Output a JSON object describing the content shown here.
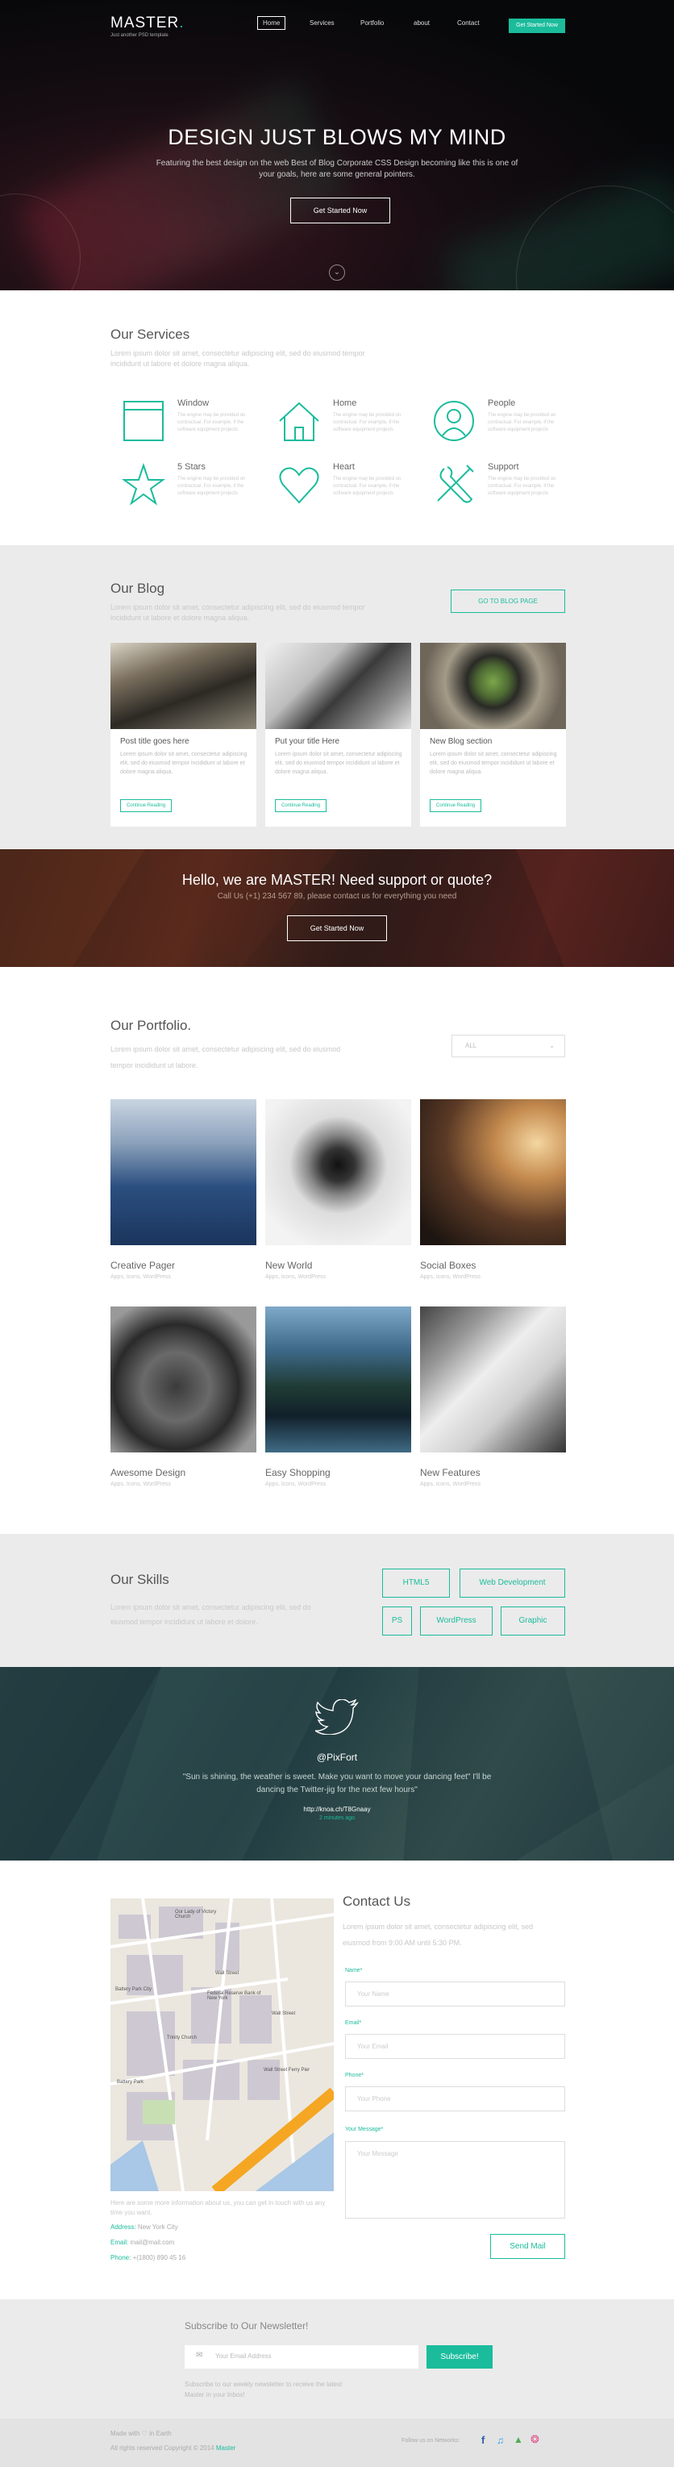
{
  "header": {
    "logo": "MASTER",
    "logo_dot": ".",
    "logo_sub": "Just another PSD template",
    "nav": [
      "Home",
      "Services",
      "Portfolio",
      "about",
      "Contact"
    ],
    "cta": "Get Started Now"
  },
  "hero": {
    "title": "DESIGN JUST BLOWS MY MIND",
    "subtitle": "Featuring the best design on the web Best of Blog Corporate CSS Design becoming like this is one of your goals, here are some general pointers.",
    "button": "Get Started Now"
  },
  "services": {
    "title": "Our Services",
    "intro": "Lorem ipsum dolor sit amet, consectetur adipiscing elit, sed do eiusmod tempor incididunt ut labore et dolore magna aliqua.",
    "items": [
      {
        "icon": "window-icon",
        "title": "Window",
        "desc": "The engine may be provided on contractual. For example, if the software equipment projects"
      },
      {
        "icon": "home-icon",
        "title": "Home",
        "desc": "The engine may be provided on contractual. For example, if the software equipment projects"
      },
      {
        "icon": "people-icon",
        "title": "People",
        "desc": "The engine may be provided on contractual. For example, if the software equipment projects"
      },
      {
        "icon": "star-icon",
        "title": "5 Stars",
        "desc": "The engine may be provided on contractual. For example, if the software equipment projects"
      },
      {
        "icon": "heart-icon",
        "title": "Heart",
        "desc": "The engine may be provided on contractual. For example, if the software equipment projects"
      },
      {
        "icon": "tools-icon",
        "title": "Support",
        "desc": "The engine may be provided on contractual. For example, if the software equipment projects"
      }
    ]
  },
  "blog": {
    "title": "Our Blog",
    "intro": "Lorem ipsum dolor sit amet, consectetur adipiscing elit, sed do eiusmod tempor incididunt ut labore et dolore magna aliqua.",
    "button": "GO TO BLOG PAGE",
    "posts": [
      {
        "title": "Post title goes here",
        "excerpt": "Lorem ipsum dolor sit amet, consectetur adipiscing elit, sed do eiusmod tempor incididunt ut labore et dolore magna aliqua.",
        "button": "Continue Reading"
      },
      {
        "title": "Put your title Here",
        "excerpt": "Lorem ipsum dolor sit amet, consectetur adipiscing elit, sed do eiusmod tempor incididunt ut labore et dolore magna aliqua.",
        "button": "Continue Reading"
      },
      {
        "title": "New Blog section",
        "excerpt": "Lorem ipsum dolor sit amet, consectetur adipiscing elit, sed do eiusmod tempor incididunt ut labore et dolore magna aliqua.",
        "button": "Continue Reading"
      }
    ]
  },
  "quote": {
    "title": "Hello, we are MASTER! Need support or quote?",
    "subtitle": "Call Us (+1) 234 567 89, please contact us for everything you need",
    "button": "Get Started Now"
  },
  "portfolio": {
    "title": "Our Portfolio.",
    "intro": "Lorem ipsum dolor sit amet, consectetur adipiscing elit, sed do eiusmod tempor incididunt ut labore.",
    "filter": "ALL",
    "items": [
      {
        "title": "Creative Pager",
        "tags": "Apps, Icons, WordPress"
      },
      {
        "title": "New World",
        "tags": "Apps, Icons, WordPress"
      },
      {
        "title": "Social Boxes",
        "tags": "Apps, Icons, WordPress"
      },
      {
        "title": "Awesome Design",
        "tags": "Apps, Icons, WordPress"
      },
      {
        "title": "Easy Shopping",
        "tags": "Apps, Icons, WordPress"
      },
      {
        "title": "New Features",
        "tags": "Apps, Icons, WordPress"
      }
    ]
  },
  "skills": {
    "title": "Our Skills",
    "intro": "Lorem ipsum dolor sit amet, consectetur adipiscing elit, sed do eiusmod tempor incididunt ut labore et dolore.",
    "tags": [
      "HTML5",
      "Web Development",
      "PS",
      "WordPress",
      "Graphic"
    ]
  },
  "tweet": {
    "handle": "@PixFort",
    "text": "\"Sun is shining, the weather is sweet. Make you want to move your dancing feet\" I'll be dancing the Twitter-jig for the next few hours\"",
    "link": "http://knoa.ch/T8Gnaay",
    "time": "2 minutes ago"
  },
  "contact": {
    "title": "Contact Us",
    "intro": "Lorem ipsum dolor sit amet, consectetur adipiscing elit, sed eiusmod from 9:00 AM until 5:30 PM.",
    "fields": [
      {
        "label": "Name*",
        "placeholder": "Your Name"
      },
      {
        "label": "Email*",
        "placeholder": "Your Email"
      },
      {
        "label": "Phone*",
        "placeholder": "Your Phone"
      },
      {
        "label": "Your Message*",
        "placeholder": "Your Message"
      }
    ],
    "send": "Send Mail",
    "info": "Here are some more information about us, you can get in touch with us any time you want.",
    "address_label": "Address:",
    "address": "New York City",
    "email_label": "Email:",
    "email": "mail@mail.com",
    "phone_label": "Phone:",
    "phone": "+(1800) 890 45 16",
    "map_labels": [
      "Our Lady of Victory Church",
      "Wall Street",
      "Federal Reserve Bank of New York",
      "Wall Street",
      "Battery Park City",
      "Trinity Church",
      "Wall Street Ferry Pier",
      "Battery Park"
    ]
  },
  "newsletter": {
    "title": "Subscribe to Our Newsletter!",
    "placeholder": "Your Email Address",
    "button": "Subscribe!",
    "note": "Subscribe to our weekly newsletter to receive the latest Master in your Inbox!"
  },
  "footer": {
    "made": "Made with ♡ in Earth",
    "copyright": "All rights reserved Copyright © 2014",
    "brand": "Master",
    "follow": "Follow us on Networks:"
  },
  "colors": {
    "accent": "#1abc9c",
    "dark": "#0b0b0e",
    "light_gray": "#ebebeb"
  }
}
